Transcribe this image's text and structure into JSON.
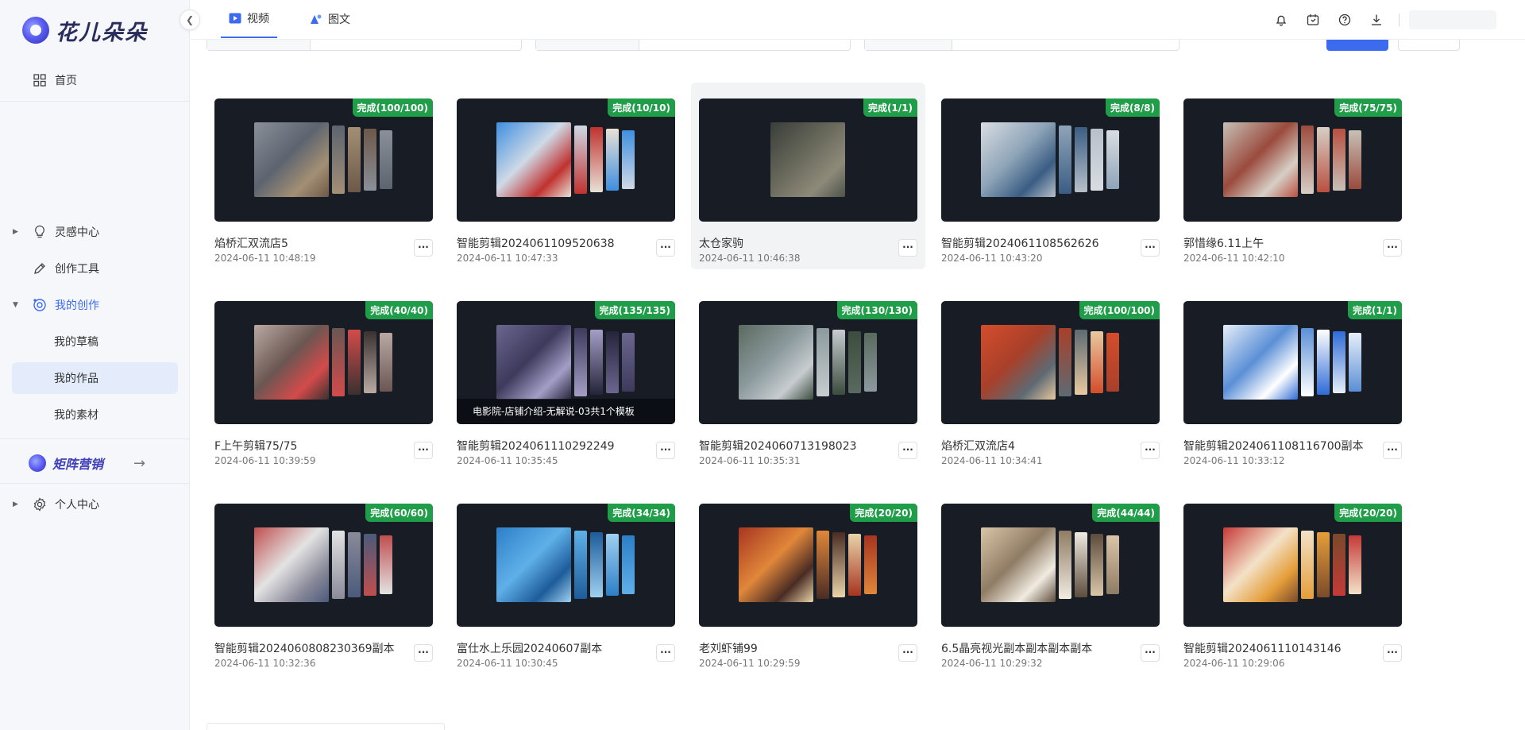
{
  "brand": {
    "name": "花儿朵朵"
  },
  "sidebar": {
    "items": [
      {
        "label": "首页",
        "icon": "grid-icon"
      },
      {
        "label": "灵感中心",
        "icon": "lightbulb-icon"
      },
      {
        "label": "创作工具",
        "icon": "pen-icon"
      },
      {
        "label": "我的创作",
        "icon": "palette-icon"
      },
      {
        "label": "个人中心",
        "icon": "gear-icon"
      }
    ],
    "sub_items": [
      {
        "label": "我的草稿"
      },
      {
        "label": "我的作品"
      },
      {
        "label": "我的素材"
      }
    ],
    "matrix": {
      "label": "矩阵营销"
    }
  },
  "tabs": [
    {
      "label": "视频",
      "active": true
    },
    {
      "label": "图文",
      "active": false
    }
  ],
  "colors": {
    "accent": "#3c6bf0",
    "badge": "#1f9d49",
    "thumb_bg": "#181c25",
    "sidebar_bg": "#f5f7fb"
  },
  "cards": [
    {
      "title": "焰桥汇双流店5",
      "time": "2024-06-11 10:48:19",
      "badge": "完成(100/100)"
    },
    {
      "title": "智能剪辑2024061109520638",
      "time": "2024-06-11 10:47:33",
      "badge": "完成(10/10)"
    },
    {
      "title": "太仓家驹",
      "time": "2024-06-11 10:46:38",
      "badge": "完成(1/1)"
    },
    {
      "title": "智能剪辑2024061108562626",
      "time": "2024-06-11 10:43:20",
      "badge": "完成(8/8)"
    },
    {
      "title": "郭惜缘6.11上午",
      "time": "2024-06-11 10:42:10",
      "badge": "完成(75/75)"
    },
    {
      "title": "F上午剪辑75/75",
      "time": "2024-06-11 10:39:59",
      "badge": "完成(40/40)"
    },
    {
      "title": "智能剪辑2024061110292249",
      "time": "2024-06-11 10:35:45",
      "badge": "完成(135/135)",
      "caption": "电影院-店铺介绍-无解说-03共1个模板"
    },
    {
      "title": "智能剪辑2024060713198023",
      "time": "2024-06-11 10:35:31",
      "badge": "完成(130/130)"
    },
    {
      "title": "焰桥汇双流店4",
      "time": "2024-06-11 10:34:41",
      "badge": "完成(100/100)"
    },
    {
      "title": "智能剪辑2024061108116700副本",
      "time": "2024-06-11 10:33:12",
      "badge": "完成(1/1)"
    },
    {
      "title": "智能剪辑2024060808230369副本",
      "time": "2024-06-11 10:32:36",
      "badge": "完成(60/60)"
    },
    {
      "title": "富仕水上乐园20240607副本",
      "time": "2024-06-11 10:30:45",
      "badge": "完成(34/34)"
    },
    {
      "title": "老刘虾铺99",
      "time": "2024-06-11 10:29:59",
      "badge": "完成(20/20)"
    },
    {
      "title": "6.5晶亮视光副本副本副本副本",
      "time": "2024-06-11 10:29:32",
      "badge": "完成(44/44)"
    },
    {
      "title": "智能剪辑2024061110143146",
      "time": "2024-06-11 10:29:06",
      "badge": "完成(20/20)"
    }
  ],
  "more_label": "···"
}
